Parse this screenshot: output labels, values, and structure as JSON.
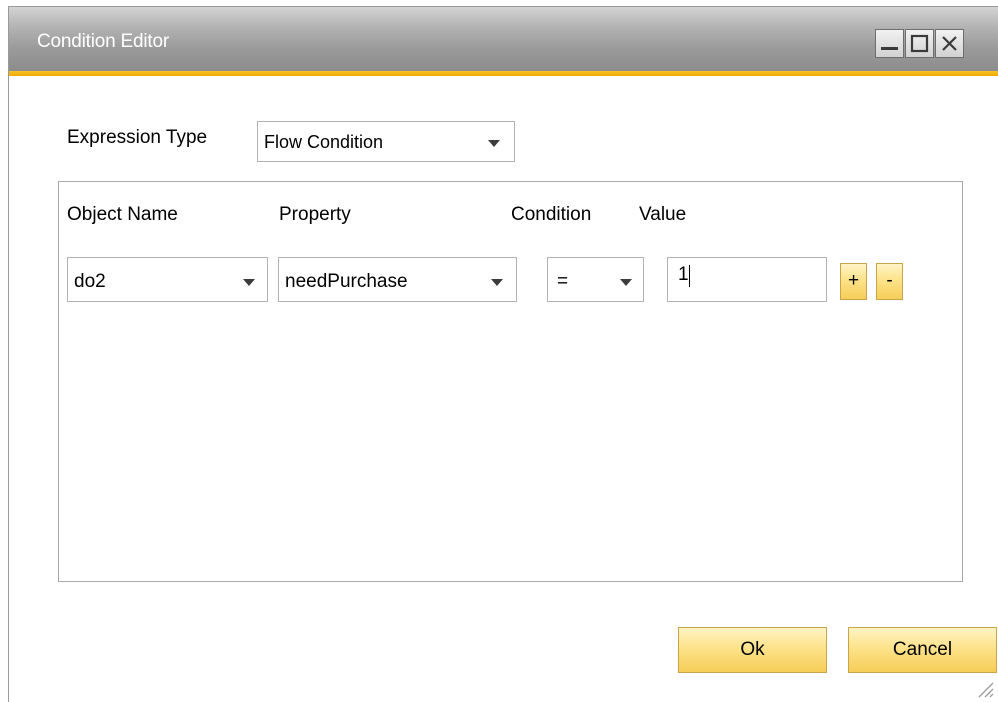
{
  "window": {
    "title": "Condition Editor",
    "controls": {
      "minimize": "minimize-icon",
      "maximize": "maximize-icon",
      "close": "close-icon"
    }
  },
  "expression_type": {
    "label": "Expression Type",
    "selected": "Flow Condition"
  },
  "condition_table": {
    "headers": [
      "Object Name",
      "Property",
      "Condition",
      "Value"
    ],
    "rows": [
      {
        "object_name": "do2",
        "property": "needPurchase",
        "condition": "=",
        "value": "1",
        "add_label": "+",
        "remove_label": "-"
      }
    ]
  },
  "footer": {
    "ok_label": "Ok",
    "cancel_label": "Cancel"
  },
  "colors": {
    "title_accent": "#f0ad00",
    "button_fill": "#fde38a",
    "titlebar": "#9a9a9a"
  }
}
